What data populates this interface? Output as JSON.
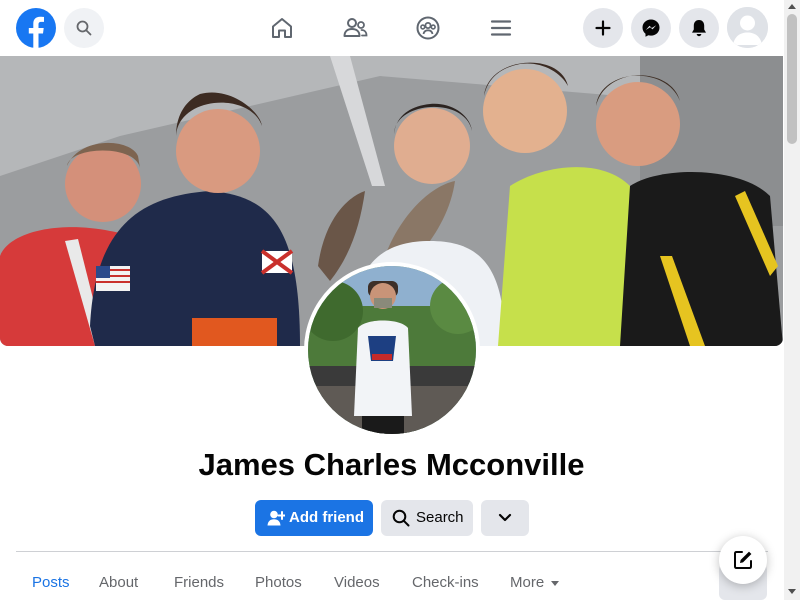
{
  "topbar": {
    "logo_icon": "facebook-logo-icon",
    "search_icon": "search-icon",
    "nav_icons": [
      "home-icon",
      "friends-icon",
      "groups-icon",
      "menu-icon"
    ],
    "right_icons": [
      "plus-icon",
      "messenger-icon",
      "bell-icon",
      "avatar-icon"
    ],
    "brand_color": "#1877f2"
  },
  "profile": {
    "name": "James Charles Mcconville"
  },
  "actions": {
    "add_friend_label": "Add friend",
    "search_label": "Search",
    "more_icon": "chevron-down-icon"
  },
  "tabs": [
    {
      "label": "Posts",
      "active": true
    },
    {
      "label": "About"
    },
    {
      "label": "Friends"
    },
    {
      "label": "Photos"
    },
    {
      "label": "Videos"
    },
    {
      "label": "Check-ins"
    },
    {
      "label": "More"
    }
  ],
  "colors": {
    "accent": "#1b74e4",
    "button_gray": "#e4e6eb",
    "text_secondary": "#65676b"
  }
}
